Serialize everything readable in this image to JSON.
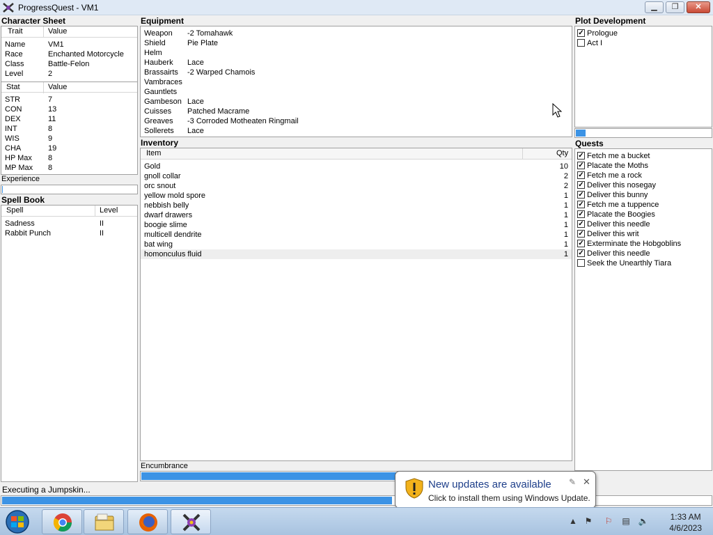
{
  "window": {
    "title": "ProgressQuest - VM1",
    "minimize": "▁",
    "maximize": "❐",
    "close": "✕"
  },
  "character_sheet": {
    "header": "Character Sheet",
    "traits_cols": [
      "Trait",
      "Value"
    ],
    "traits": [
      {
        "trait": "Name",
        "value": "VM1"
      },
      {
        "trait": "Race",
        "value": "Enchanted Motorcycle"
      },
      {
        "trait": "Class",
        "value": "Battle-Felon"
      },
      {
        "trait": "Level",
        "value": "2"
      }
    ],
    "stats_cols": [
      "Stat",
      "Value"
    ],
    "stats": [
      {
        "stat": "STR",
        "value": "7"
      },
      {
        "stat": "CON",
        "value": "13"
      },
      {
        "stat": "DEX",
        "value": "11"
      },
      {
        "stat": "INT",
        "value": "8"
      },
      {
        "stat": "WIS",
        "value": "9"
      },
      {
        "stat": "CHA",
        "value": "19"
      },
      {
        "stat": "HP Max",
        "value": "8"
      },
      {
        "stat": "MP Max",
        "value": "8"
      }
    ],
    "experience_label": "Experience",
    "experience_progress": 0.003
  },
  "spell_book": {
    "header": "Spell Book",
    "cols": [
      "Spell",
      "Level"
    ],
    "spells": [
      {
        "spell": "Sadness",
        "level": "II"
      },
      {
        "spell": "Rabbit Punch",
        "level": "II"
      }
    ]
  },
  "equipment": {
    "header": "Equipment",
    "items": [
      {
        "slot": "Weapon",
        "item": "-2 Tomahawk"
      },
      {
        "slot": "Shield",
        "item": "Pie Plate"
      },
      {
        "slot": "Helm",
        "item": ""
      },
      {
        "slot": "Hauberk",
        "item": "Lace"
      },
      {
        "slot": "Brassairts",
        "item": "-2 Warped Chamois"
      },
      {
        "slot": "Vambraces",
        "item": ""
      },
      {
        "slot": "Gauntlets",
        "item": ""
      },
      {
        "slot": "Gambeson",
        "item": "Lace"
      },
      {
        "slot": "Cuisses",
        "item": "Patched Macrame"
      },
      {
        "slot": "Greaves",
        "item": "-3 Corroded Motheaten Ringmail"
      },
      {
        "slot": "Sollerets",
        "item": "Lace"
      }
    ]
  },
  "inventory": {
    "header": "Inventory",
    "cols": [
      "Item",
      "Qty"
    ],
    "items": [
      {
        "item": "Gold",
        "qty": "10"
      },
      {
        "item": "gnoll collar",
        "qty": "2"
      },
      {
        "item": "orc snout",
        "qty": "2"
      },
      {
        "item": "yellow mold spore",
        "qty": "1"
      },
      {
        "item": "nebbish belly",
        "qty": "1"
      },
      {
        "item": "dwarf drawers",
        "qty": "1"
      },
      {
        "item": "boogie slime",
        "qty": "1"
      },
      {
        "item": "multicell dendrite",
        "qty": "1"
      },
      {
        "item": "bat wing",
        "qty": "1"
      },
      {
        "item": "homonculus fluid",
        "qty": "1"
      }
    ],
    "encumbrance_label": "Encumbrance",
    "encumbrance_progress": 1.0
  },
  "plot": {
    "header": "Plot Development",
    "acts": [
      {
        "label": "Prologue",
        "checked": true
      },
      {
        "label": "Act I",
        "checked": false
      }
    ],
    "progress": 0.07
  },
  "quests": {
    "header": "Quests",
    "items": [
      {
        "label": "Fetch me a bucket",
        "checked": true
      },
      {
        "label": "Placate the Moths",
        "checked": true
      },
      {
        "label": "Fetch me a rock",
        "checked": true
      },
      {
        "label": "Deliver this nosegay",
        "checked": true
      },
      {
        "label": "Deliver this bunny",
        "checked": true
      },
      {
        "label": "Fetch me a tuppence",
        "checked": true
      },
      {
        "label": "Placate the Boogies",
        "checked": true
      },
      {
        "label": "Deliver this needle",
        "checked": true
      },
      {
        "label": "Deliver this writ",
        "checked": true
      },
      {
        "label": "Exterminate the Hobgoblins",
        "checked": true
      },
      {
        "label": "Deliver this needle",
        "checked": true
      },
      {
        "label": "Seek the Unearthly Tiara",
        "checked": false
      }
    ]
  },
  "status": {
    "task": "Executing a Jumpskin...",
    "task_progress": 0.55
  },
  "notification": {
    "title": "New updates are available",
    "message": "Click to install them using Windows Update."
  },
  "taskbar": {
    "pinned": [
      "chrome-icon",
      "explorer-icon",
      "firefox-icon",
      "progressquest-icon"
    ],
    "time": "1:33 AM",
    "date": "4/6/2023"
  }
}
